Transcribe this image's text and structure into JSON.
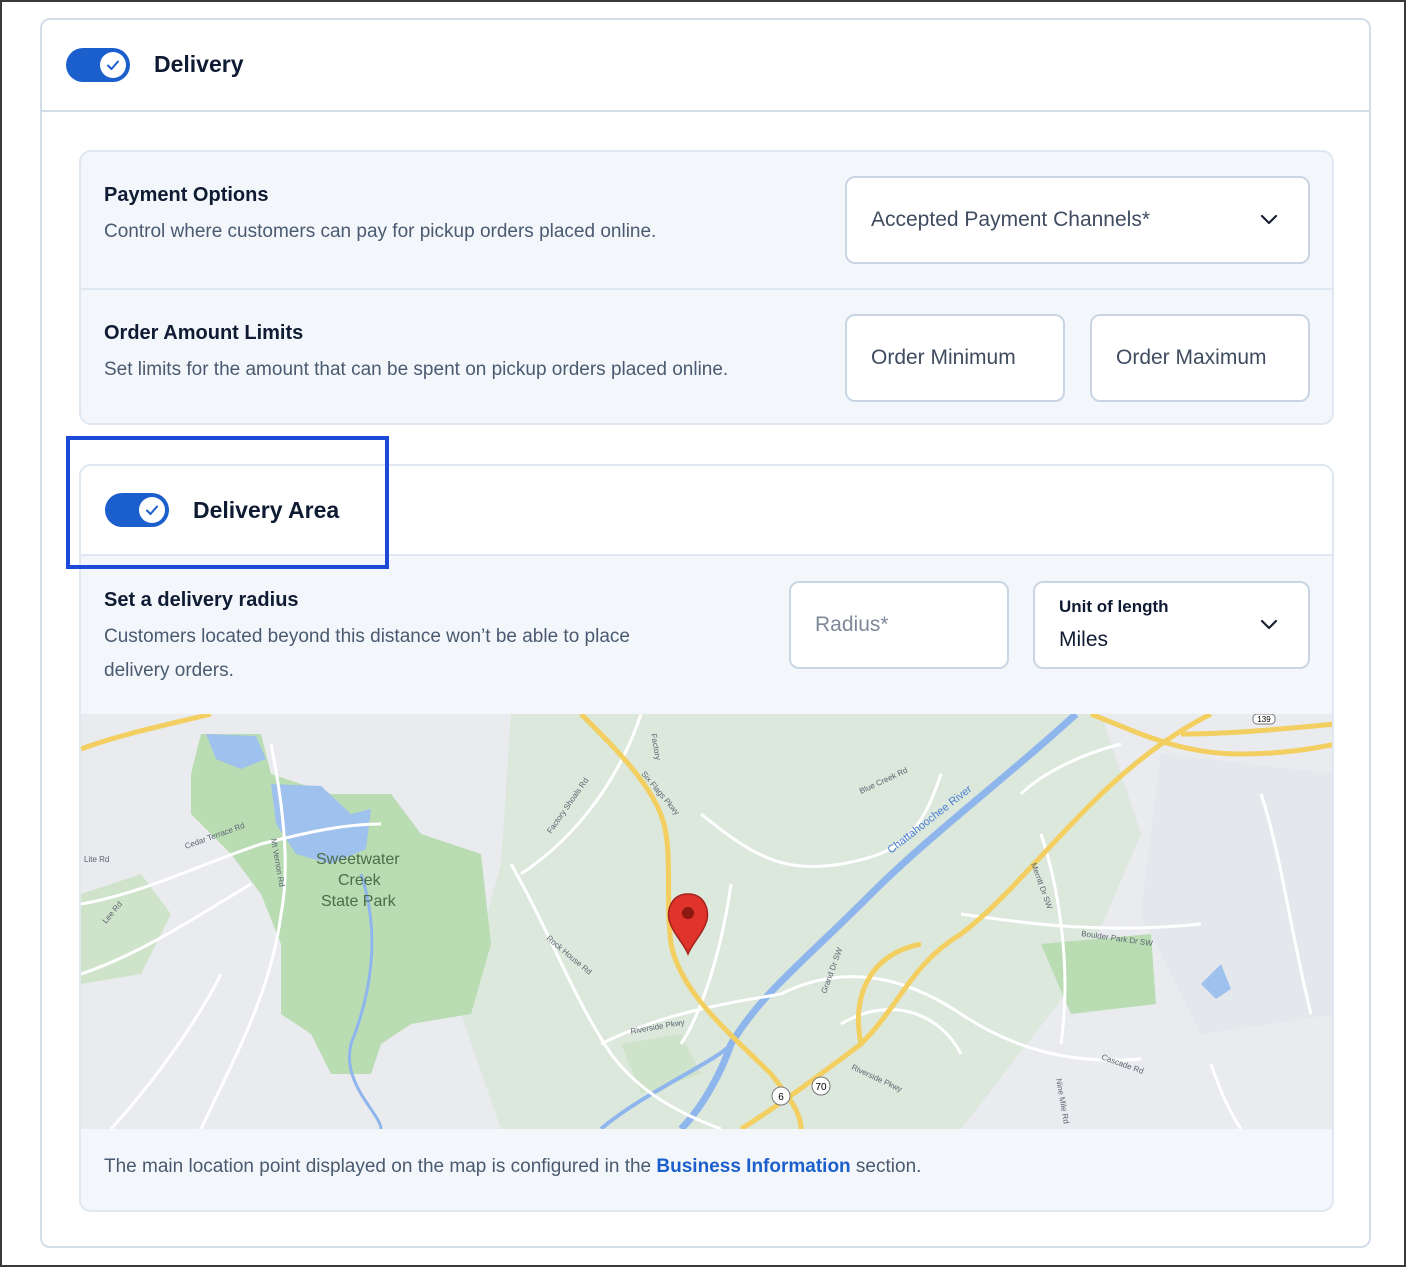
{
  "delivery": {
    "title": "Delivery",
    "toggle_on": true
  },
  "payment_options": {
    "title": "Payment Options",
    "description": "Control where customers can pay for pickup orders placed online.",
    "channels_placeholder": "Accepted Payment Channels*"
  },
  "order_limits": {
    "title": "Order Amount Limits",
    "description": "Set limits for the amount that can be spent on pickup orders placed online.",
    "minimum_placeholder": "Order Minimum",
    "maximum_placeholder": "Order Maximum"
  },
  "delivery_area": {
    "title": "Delivery Area",
    "toggle_on": true,
    "radius_title": "Set a delivery radius",
    "radius_desc_line1": "Customers located beyond this distance won’t be able to place",
    "radius_desc_line2": "delivery orders.",
    "radius_placeholder": "Radius*",
    "unit_label": "Unit of length",
    "unit_value": "Miles"
  },
  "map": {
    "labels": {
      "park": [
        "Sweetwater",
        "Creek",
        "State Park"
      ],
      "river": "Chattahoochee River",
      "roads": [
        "Cedar Terrace Rd",
        "Mt Vernon Rd",
        "Factory Shoals Rd",
        "Six Flags Pkwy",
        "Riverside Pkwy",
        "Blue Creek Rd",
        "Rock House Rd",
        "Lee Rd",
        "Lite Rd",
        "Cascade Rd",
        "Boulder Park Dr SW",
        "Merritt Dr SW",
        "Grand Dr SW",
        "Nine Mile Rd",
        "Factory",
        "Riverside Pkwy"
      ],
      "shields": [
        "6",
        "70",
        "139"
      ]
    }
  },
  "footer": {
    "text_before": "The main location point displayed on the map is configured in the ",
    "link": "Business Information",
    "text_after": " section."
  },
  "colors": {
    "accent": "#1b5fcc",
    "highlight": "#1d49d9",
    "pin": "#d93025"
  }
}
